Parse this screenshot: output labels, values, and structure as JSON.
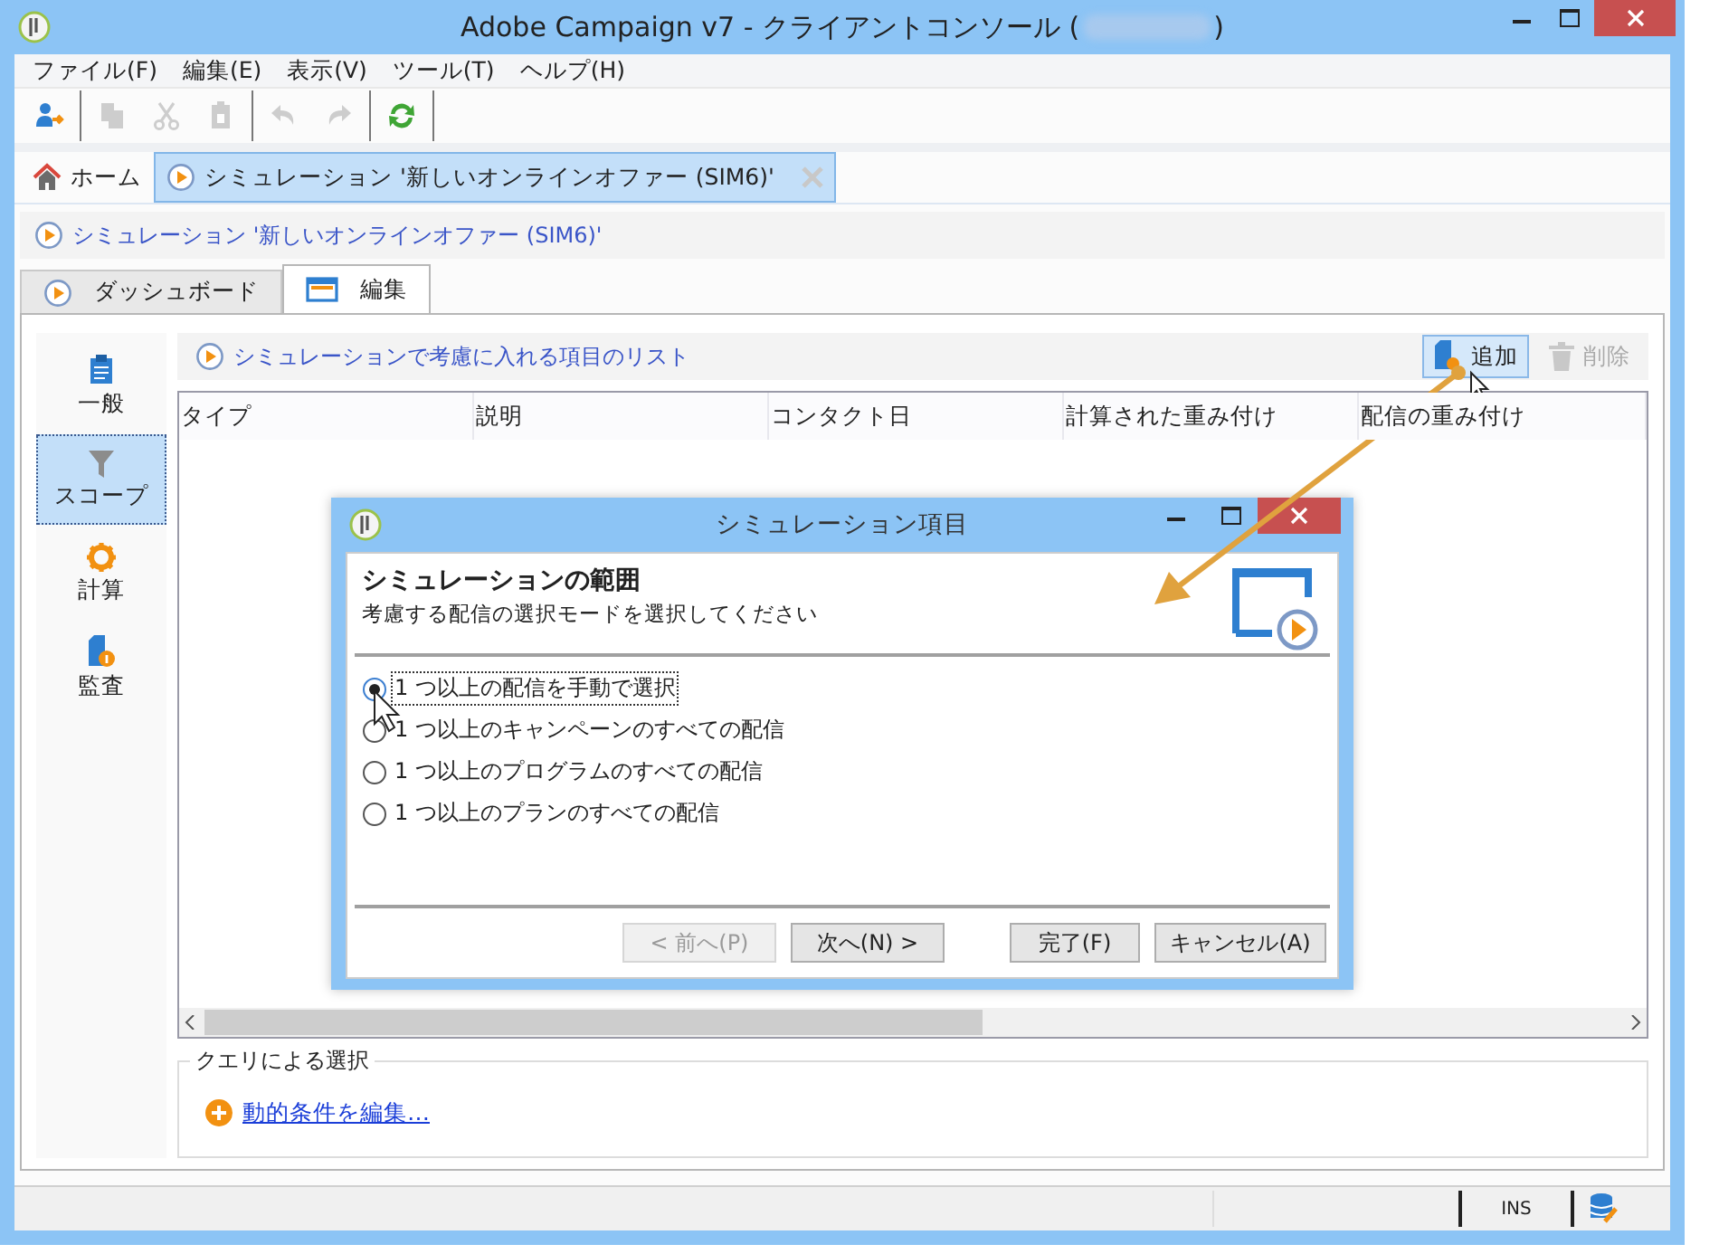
{
  "window": {
    "title": "Adobe Campaign v7 - クライアントコンソール (",
    "title_end": ")"
  },
  "menu": [
    "ファイル(F)",
    "編集(E)",
    "表示(V)",
    "ツール(T)",
    "ヘルプ(H)"
  ],
  "toolbar": [
    {
      "kind": "connect",
      "disabled": false,
      "separator_after": true
    },
    {
      "kind": "copy",
      "disabled": true,
      "separator_after": false
    },
    {
      "kind": "cut",
      "disabled": true,
      "separator_after": false
    },
    {
      "kind": "paste",
      "disabled": true,
      "separator_after": true
    },
    {
      "kind": "undo",
      "disabled": true,
      "separator_after": false
    },
    {
      "kind": "redo",
      "disabled": true,
      "separator_after": true
    },
    {
      "kind": "refresh",
      "disabled": false,
      "separator_after": true
    }
  ],
  "tabs": [
    {
      "label": "ホーム",
      "kind": "home",
      "selected": false,
      "closable": false
    },
    {
      "label": "シミュレーション '新しいオンラインオファー (SIM6)'",
      "kind": "document",
      "selected": true,
      "closable": true
    }
  ],
  "breadcrumb": "シミュレーション '新しいオンラインオファー (SIM6)'",
  "subtabs": [
    {
      "label": "ダッシュボード",
      "kind": "dashboard",
      "selected": false
    },
    {
      "label": "編集",
      "kind": "edit",
      "selected": true
    }
  ],
  "sidebar": [
    {
      "label": "一般",
      "kind": "general",
      "selected": false
    },
    {
      "label": "スコープ",
      "kind": "scope",
      "selected": true
    },
    {
      "label": "計算",
      "kind": "calc",
      "selected": false
    },
    {
      "label": "監査",
      "kind": "audit",
      "selected": false
    }
  ],
  "list": {
    "title": "シミュレーションで考慮に入れる項目のリスト",
    "buttons": [
      {
        "label": "追加",
        "kind": "add",
        "disabled": false
      },
      {
        "label": "削除",
        "kind": "delete",
        "disabled": true
      }
    ],
    "columns": [
      "タイプ",
      "説明",
      "コンタクト日",
      "計算された重み付け",
      "配信の重み付け"
    ]
  },
  "query": {
    "legend": "クエリによる選択",
    "link": "動的条件を編集…"
  },
  "status_bar": {
    "mode": "INS"
  },
  "dialog": {
    "title": "シミュレーション項目",
    "heading": "シミュレーションの範囲",
    "subtitle": "考慮する配信の選択モードを選択してください",
    "options": [
      {
        "label": "1 つ以上の配信を手動で選択",
        "selected": true
      },
      {
        "label": "1 つ以上のキャンペーンのすべての配信",
        "selected": false
      },
      {
        "label": "1 つ以上のプログラムのすべての配信",
        "selected": false
      },
      {
        "label": "1 つ以上のプランのすべての配信",
        "selected": false
      }
    ],
    "buttons": [
      {
        "label": "< 前へ(P)",
        "disabled": true
      },
      {
        "label": "次へ(N) >",
        "disabled": false
      },
      {
        "label": "完了(F)",
        "disabled": false
      },
      {
        "label": "キャンセル(A)",
        "disabled": false
      }
    ]
  }
}
